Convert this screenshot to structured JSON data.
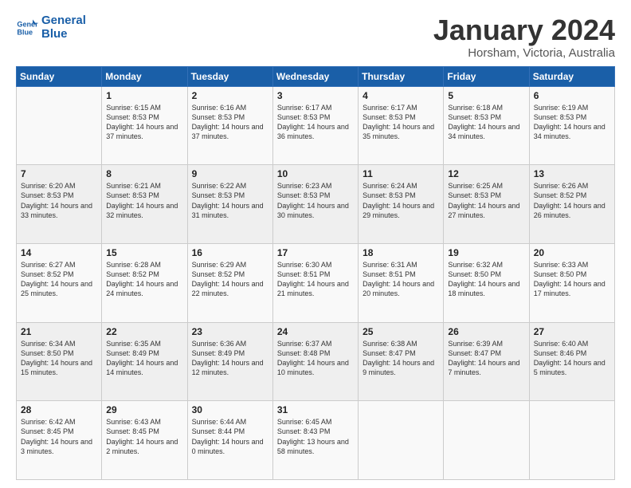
{
  "logo": {
    "line1": "General",
    "line2": "Blue"
  },
  "title": "January 2024",
  "location": "Horsham, Victoria, Australia",
  "header": {
    "days": [
      "Sunday",
      "Monday",
      "Tuesday",
      "Wednesday",
      "Thursday",
      "Friday",
      "Saturday"
    ]
  },
  "weeks": [
    [
      {
        "day": "",
        "sunrise": "",
        "sunset": "",
        "daylight": ""
      },
      {
        "day": "1",
        "sunrise": "Sunrise: 6:15 AM",
        "sunset": "Sunset: 8:53 PM",
        "daylight": "Daylight: 14 hours and 37 minutes."
      },
      {
        "day": "2",
        "sunrise": "Sunrise: 6:16 AM",
        "sunset": "Sunset: 8:53 PM",
        "daylight": "Daylight: 14 hours and 37 minutes."
      },
      {
        "day": "3",
        "sunrise": "Sunrise: 6:17 AM",
        "sunset": "Sunset: 8:53 PM",
        "daylight": "Daylight: 14 hours and 36 minutes."
      },
      {
        "day": "4",
        "sunrise": "Sunrise: 6:17 AM",
        "sunset": "Sunset: 8:53 PM",
        "daylight": "Daylight: 14 hours and 35 minutes."
      },
      {
        "day": "5",
        "sunrise": "Sunrise: 6:18 AM",
        "sunset": "Sunset: 8:53 PM",
        "daylight": "Daylight: 14 hours and 34 minutes."
      },
      {
        "day": "6",
        "sunrise": "Sunrise: 6:19 AM",
        "sunset": "Sunset: 8:53 PM",
        "daylight": "Daylight: 14 hours and 34 minutes."
      }
    ],
    [
      {
        "day": "7",
        "sunrise": "Sunrise: 6:20 AM",
        "sunset": "Sunset: 8:53 PM",
        "daylight": "Daylight: 14 hours and 33 minutes."
      },
      {
        "day": "8",
        "sunrise": "Sunrise: 6:21 AM",
        "sunset": "Sunset: 8:53 PM",
        "daylight": "Daylight: 14 hours and 32 minutes."
      },
      {
        "day": "9",
        "sunrise": "Sunrise: 6:22 AM",
        "sunset": "Sunset: 8:53 PM",
        "daylight": "Daylight: 14 hours and 31 minutes."
      },
      {
        "day": "10",
        "sunrise": "Sunrise: 6:23 AM",
        "sunset": "Sunset: 8:53 PM",
        "daylight": "Daylight: 14 hours and 30 minutes."
      },
      {
        "day": "11",
        "sunrise": "Sunrise: 6:24 AM",
        "sunset": "Sunset: 8:53 PM",
        "daylight": "Daylight: 14 hours and 29 minutes."
      },
      {
        "day": "12",
        "sunrise": "Sunrise: 6:25 AM",
        "sunset": "Sunset: 8:53 PM",
        "daylight": "Daylight: 14 hours and 27 minutes."
      },
      {
        "day": "13",
        "sunrise": "Sunrise: 6:26 AM",
        "sunset": "Sunset: 8:52 PM",
        "daylight": "Daylight: 14 hours and 26 minutes."
      }
    ],
    [
      {
        "day": "14",
        "sunrise": "Sunrise: 6:27 AM",
        "sunset": "Sunset: 8:52 PM",
        "daylight": "Daylight: 14 hours and 25 minutes."
      },
      {
        "day": "15",
        "sunrise": "Sunrise: 6:28 AM",
        "sunset": "Sunset: 8:52 PM",
        "daylight": "Daylight: 14 hours and 24 minutes."
      },
      {
        "day": "16",
        "sunrise": "Sunrise: 6:29 AM",
        "sunset": "Sunset: 8:52 PM",
        "daylight": "Daylight: 14 hours and 22 minutes."
      },
      {
        "day": "17",
        "sunrise": "Sunrise: 6:30 AM",
        "sunset": "Sunset: 8:51 PM",
        "daylight": "Daylight: 14 hours and 21 minutes."
      },
      {
        "day": "18",
        "sunrise": "Sunrise: 6:31 AM",
        "sunset": "Sunset: 8:51 PM",
        "daylight": "Daylight: 14 hours and 20 minutes."
      },
      {
        "day": "19",
        "sunrise": "Sunrise: 6:32 AM",
        "sunset": "Sunset: 8:50 PM",
        "daylight": "Daylight: 14 hours and 18 minutes."
      },
      {
        "day": "20",
        "sunrise": "Sunrise: 6:33 AM",
        "sunset": "Sunset: 8:50 PM",
        "daylight": "Daylight: 14 hours and 17 minutes."
      }
    ],
    [
      {
        "day": "21",
        "sunrise": "Sunrise: 6:34 AM",
        "sunset": "Sunset: 8:50 PM",
        "daylight": "Daylight: 14 hours and 15 minutes."
      },
      {
        "day": "22",
        "sunrise": "Sunrise: 6:35 AM",
        "sunset": "Sunset: 8:49 PM",
        "daylight": "Daylight: 14 hours and 14 minutes."
      },
      {
        "day": "23",
        "sunrise": "Sunrise: 6:36 AM",
        "sunset": "Sunset: 8:49 PM",
        "daylight": "Daylight: 14 hours and 12 minutes."
      },
      {
        "day": "24",
        "sunrise": "Sunrise: 6:37 AM",
        "sunset": "Sunset: 8:48 PM",
        "daylight": "Daylight: 14 hours and 10 minutes."
      },
      {
        "day": "25",
        "sunrise": "Sunrise: 6:38 AM",
        "sunset": "Sunset: 8:47 PM",
        "daylight": "Daylight: 14 hours and 9 minutes."
      },
      {
        "day": "26",
        "sunrise": "Sunrise: 6:39 AM",
        "sunset": "Sunset: 8:47 PM",
        "daylight": "Daylight: 14 hours and 7 minutes."
      },
      {
        "day": "27",
        "sunrise": "Sunrise: 6:40 AM",
        "sunset": "Sunset: 8:46 PM",
        "daylight": "Daylight: 14 hours and 5 minutes."
      }
    ],
    [
      {
        "day": "28",
        "sunrise": "Sunrise: 6:42 AM",
        "sunset": "Sunset: 8:45 PM",
        "daylight": "Daylight: 14 hours and 3 minutes."
      },
      {
        "day": "29",
        "sunrise": "Sunrise: 6:43 AM",
        "sunset": "Sunset: 8:45 PM",
        "daylight": "Daylight: 14 hours and 2 minutes."
      },
      {
        "day": "30",
        "sunrise": "Sunrise: 6:44 AM",
        "sunset": "Sunset: 8:44 PM",
        "daylight": "Daylight: 14 hours and 0 minutes."
      },
      {
        "day": "31",
        "sunrise": "Sunrise: 6:45 AM",
        "sunset": "Sunset: 8:43 PM",
        "daylight": "Daylight: 13 hours and 58 minutes."
      },
      {
        "day": "",
        "sunrise": "",
        "sunset": "",
        "daylight": ""
      },
      {
        "day": "",
        "sunrise": "",
        "sunset": "",
        "daylight": ""
      },
      {
        "day": "",
        "sunrise": "",
        "sunset": "",
        "daylight": ""
      }
    ]
  ]
}
